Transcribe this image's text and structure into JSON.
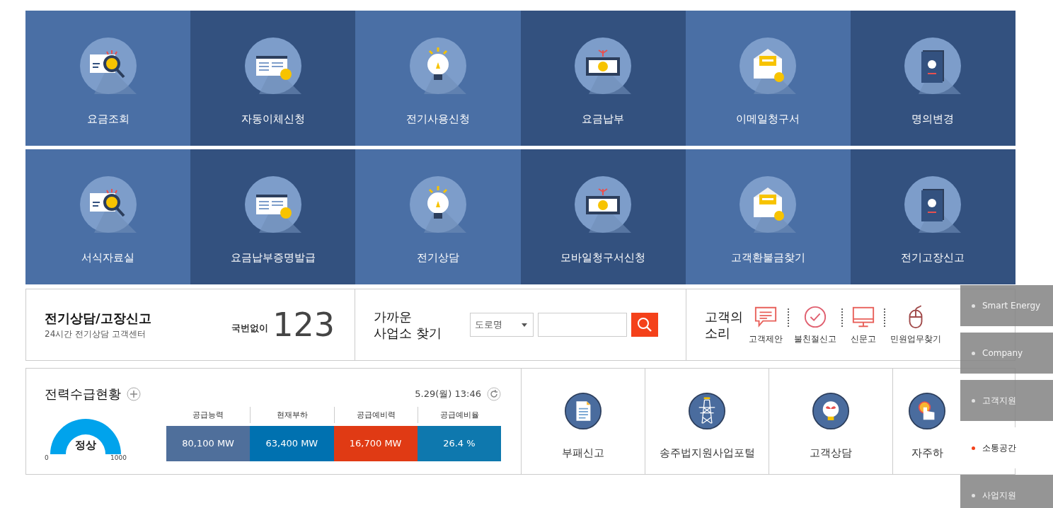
{
  "tile_rows": [
    [
      {
        "label": "요금조회",
        "kind": "search"
      },
      {
        "label": "자동이체신청",
        "kind": "card"
      },
      {
        "label": "전기사용신청",
        "kind": "bulb"
      },
      {
        "label": "요금납부",
        "kind": "money"
      },
      {
        "label": "이메일청구서",
        "kind": "mail"
      },
      {
        "label": "명의변경",
        "kind": "passport"
      }
    ],
    [
      {
        "label": "서식자료실",
        "kind": "search"
      },
      {
        "label": "요금납부증명발급",
        "kind": "card"
      },
      {
        "label": "전기상담",
        "kind": "bulb"
      },
      {
        "label": "모바일청구서신청",
        "kind": "money"
      },
      {
        "label": "고객환불금찾기",
        "kind": "mail"
      },
      {
        "label": "전기고장신고",
        "kind": "passport"
      }
    ]
  ],
  "call_center": {
    "title": "전기상담/고장신고",
    "subtitle": "24시간 전기상담 고객센터",
    "prefix": "국번없이",
    "number": "123"
  },
  "office_search": {
    "title_lines": [
      "가까운",
      "사업소 찾기"
    ],
    "select": "도로명"
  },
  "voice": {
    "title_lines": [
      "고객의",
      "소리"
    ],
    "items": [
      {
        "label": "고객제안",
        "kind": "chat"
      },
      {
        "label": "불친절신고",
        "kind": "check"
      },
      {
        "label": "신문고",
        "kind": "monitor"
      },
      {
        "label": "민원업무찾기",
        "kind": "mouse"
      }
    ]
  },
  "power": {
    "title": "전력수급현황",
    "timestamp": "5.29(월) 13:46",
    "gauge": {
      "status": "정상",
      "min": "0",
      "max": "1000"
    },
    "stats": [
      {
        "label": "공급능력",
        "value": "80,100 MW",
        "color": "#4f6f9b"
      },
      {
        "label": "현재부하",
        "value": "63,400 MW",
        "color": "#0071b0"
      },
      {
        "label": "공급예비력",
        "value": "16,700 MW",
        "color": "#e03a14"
      },
      {
        "label": "공급예비율",
        "value": "26.4 %",
        "color": "#0e78ae"
      }
    ]
  },
  "quick_links": [
    {
      "label": "부패신고",
      "kind": "document"
    },
    {
      "label": "송주법지원사업포털",
      "kind": "tower"
    },
    {
      "label": "고객상담",
      "kind": "bulb"
    },
    {
      "label": "자주하",
      "kind": "touch"
    }
  ],
  "side_nav": [
    {
      "label": "Smart Energy",
      "selected": false
    },
    {
      "label": "Company",
      "selected": false
    },
    {
      "label": "고객지원",
      "selected": false
    },
    {
      "label": "소통공간",
      "selected": true
    },
    {
      "label": "사업지원",
      "selected": false
    }
  ]
}
